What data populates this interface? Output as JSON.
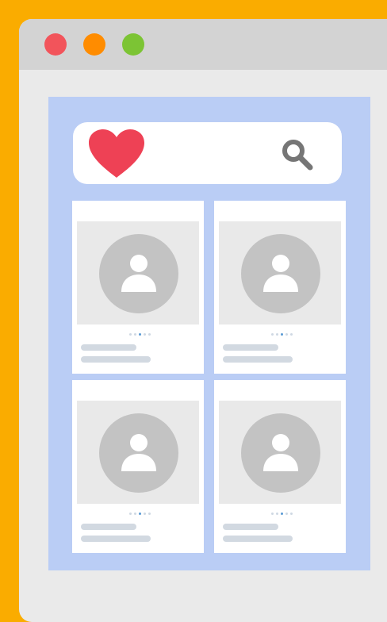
{
  "colors": {
    "background": "#FAAC00",
    "window": "#EAEAEA",
    "titlebar": "#D3D3D3",
    "app_background": "#BACDF5",
    "close": "#F2545B",
    "minimize": "#FF8C00",
    "maximize": "#7CC434",
    "heart": "#EE4155",
    "search": "#767676",
    "avatar": "#C3C3C3",
    "media": "#E9E9E9",
    "text_placeholder": "#D2D9E1"
  },
  "window": {
    "controls": [
      "close-icon",
      "minimize-icon",
      "maximize-icon"
    ]
  },
  "header": {
    "logo_icon": "heart-icon",
    "search_icon": "search-icon"
  },
  "profiles": [
    {
      "avatar_icon": "user-icon",
      "active_slide": 3,
      "slides": 4
    },
    {
      "avatar_icon": "user-icon",
      "active_slide": 3,
      "slides": 4
    },
    {
      "avatar_icon": "user-icon",
      "active_slide": 3,
      "slides": 4
    },
    {
      "avatar_icon": "user-icon",
      "active_slide": 3,
      "slides": 4
    }
  ]
}
